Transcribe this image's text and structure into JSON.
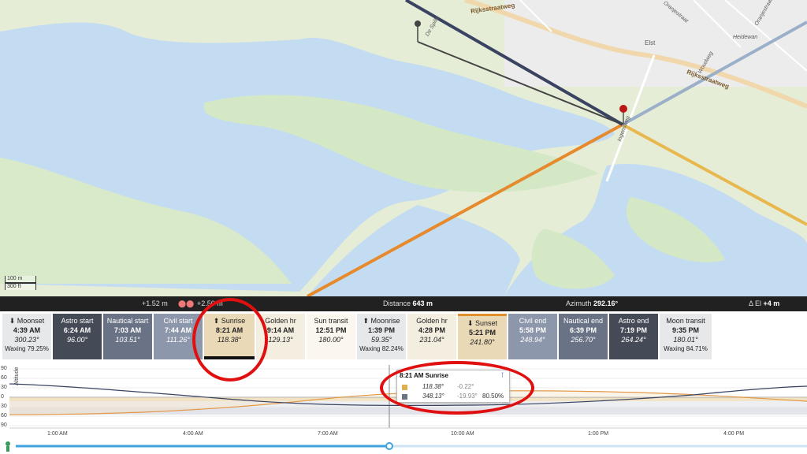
{
  "map": {
    "road_1": "Rijksstraatweg",
    "road_2": "Rijksstraatweg",
    "street_1": "Oranjestraat",
    "street_2": "Heidewan",
    "street_3": "Woudweg",
    "street_4": "Oranjestraat",
    "street_5": "De Spille",
    "street_6": "Ingensweg",
    "place_1": "Elst",
    "scale_m": "100 m",
    "scale_ft": "300 ft",
    "colors": {
      "water": "#c4dcf1",
      "land": "#e6edd6",
      "green": "#cfe6c4",
      "sun_line": "#e68a2e",
      "moon_line": "#3a4462"
    }
  },
  "infobar": {
    "height1": "+1.52 m",
    "height2": "+2.50 m",
    "distance_label": "Distance",
    "distance_value": "643 m",
    "azimuth_label": "Azimuth",
    "azimuth_value": "292.16°",
    "elev_label": "Δ El",
    "elev_value": "+4 m"
  },
  "events": [
    {
      "title": "⬇ Moonset",
      "time": "4:39 AM",
      "az": "300.23°",
      "extra": "Waxing 79.25%"
    },
    {
      "title": "Astro start",
      "time": "6:24 AM",
      "az": "96.00°",
      "extra": ""
    },
    {
      "title": "Nautical start",
      "time": "7:03 AM",
      "az": "103.51°",
      "extra": ""
    },
    {
      "title": "Civil start",
      "time": "7:44 AM",
      "az": "111.26°",
      "extra": ""
    },
    {
      "title": "⬆ Sunrise",
      "time": "8:21 AM",
      "az": "118.38°",
      "extra": ""
    },
    {
      "title": "Golden hr",
      "time": "9:14 AM",
      "az": "129.13°",
      "extra": ""
    },
    {
      "title": "Sun transit",
      "time": "12:51 PM",
      "az": "180.00°",
      "extra": ""
    },
    {
      "title": "⬆ Moonrise",
      "time": "1:39 PM",
      "az": "59.35°",
      "extra": "Waxing 82.24%"
    },
    {
      "title": "Golden hr",
      "time": "4:28 PM",
      "az": "231.04°",
      "extra": ""
    },
    {
      "title": "⬇ Sunset",
      "time": "5:21 PM",
      "az": "241.80°",
      "extra": ""
    },
    {
      "title": "Civil end",
      "time": "5:58 PM",
      "az": "248.94°",
      "extra": ""
    },
    {
      "title": "Nautical end",
      "time": "6:39 PM",
      "az": "256.70°",
      "extra": ""
    },
    {
      "title": "Astro end",
      "time": "7:19 PM",
      "az": "264.24°",
      "extra": ""
    },
    {
      "title": "Moon transit",
      "time": "9:35 PM",
      "az": "180.01°",
      "extra": "Waxing 84.71%"
    }
  ],
  "graph": {
    "y_title": "Altitude",
    "y_ticks": [
      "90",
      "60",
      "30",
      "0",
      "30",
      "60",
      "90"
    ],
    "x_ticks": [
      "1:00 AM",
      "4:00 AM",
      "7:00 AM",
      "10:00 AM",
      "1:00 PM",
      "4:00 PM"
    ],
    "tooltip": {
      "title": "8:21 AM Sunrise",
      "sun_az": "118.38°",
      "sun_alt": "-0.22°",
      "moon_az": "348.13°",
      "moon_alt": "-19.93°",
      "moon_illum": "80.50%",
      "sun_color": "#e0b04e",
      "moon_color": "#6b7385"
    },
    "slider_icon": "person-icon"
  }
}
